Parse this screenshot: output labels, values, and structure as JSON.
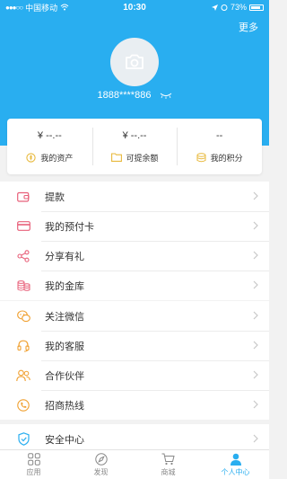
{
  "status_bar": {
    "carrier": "中国移动",
    "time": "10:30",
    "battery": "73%"
  },
  "header": {
    "more_label": "更多",
    "phone": "1888****886"
  },
  "assets": [
    {
      "value": "¥ --.--",
      "label": "我的资产",
      "icon": "coin-icon"
    },
    {
      "value": "¥ --.--",
      "label": "可提余额",
      "icon": "folder-icon"
    },
    {
      "value": "--",
      "label": "我的积分",
      "icon": "points-stack-icon"
    }
  ],
  "menu_group_1": [
    {
      "label": "提款",
      "icon": "wallet-icon"
    },
    {
      "label": "我的预付卡",
      "icon": "card-icon"
    },
    {
      "label": "分享有礼",
      "icon": "share-icon"
    },
    {
      "label": "我的金库",
      "icon": "vault-icon"
    }
  ],
  "menu_group_2": [
    {
      "label": "关注微信",
      "icon": "wechat-icon"
    },
    {
      "label": "我的客服",
      "icon": "headset-icon"
    },
    {
      "label": "合作伙伴",
      "icon": "partners-icon"
    },
    {
      "label": "招商热线",
      "icon": "phone-hotline-icon"
    }
  ],
  "menu_group_3": [
    {
      "label": "安全中心",
      "icon": "shield-icon"
    }
  ],
  "tab_bar": [
    {
      "label": "应用",
      "icon": "apps-grid-icon",
      "active": false
    },
    {
      "label": "发现",
      "icon": "compass-icon",
      "active": false
    },
    {
      "label": "商城",
      "icon": "cart-icon",
      "active": false
    },
    {
      "label": "个人中心",
      "icon": "person-icon",
      "active": true
    }
  ],
  "colors": {
    "brand": "#29aef0",
    "accent_yellow": "#e8b93c",
    "accent_pink": "#e8607a",
    "accent_orange": "#f0a030"
  }
}
